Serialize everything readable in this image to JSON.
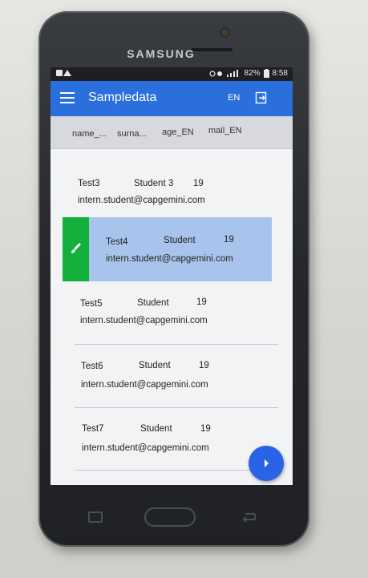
{
  "device": {
    "brand": "SAMSUNG"
  },
  "status_bar": {
    "battery": "82%",
    "time": "8:58"
  },
  "app_bar": {
    "title": "Sampledata",
    "language": "EN"
  },
  "columns": [
    "name_...",
    "surna...",
    "age_EN",
    "mail_EN"
  ],
  "rows": [
    {
      "name": "Test3",
      "surname": "Student 3",
      "age": "19",
      "mail": "intern.student@capgemini.com",
      "selected": false
    },
    {
      "name": "Test4",
      "surname": "Student",
      "age": "19",
      "mail": "intern.student@capgemini.com",
      "selected": true
    },
    {
      "name": "Test5",
      "surname": "Student",
      "age": "19",
      "mail": "intern.student@capgemini.com",
      "selected": false
    },
    {
      "name": "Test6",
      "surname": "Student",
      "age": "19",
      "mail": "intern.student@capgemini.com",
      "selected": false
    },
    {
      "name": "Test7",
      "surname": "Student",
      "age": "19",
      "mail": "intern.student@capgemini.com",
      "selected": false
    }
  ],
  "icons": {
    "menu": "hamburger-menu-icon",
    "logout": "logout-icon",
    "edit": "brush-icon",
    "fab": "chevron-right-icon"
  },
  "colors": {
    "app_bar": "#2a6fdb",
    "selected_row": "#a9c4ec",
    "edit_button": "#13b03c",
    "fab": "#2a63e6"
  }
}
